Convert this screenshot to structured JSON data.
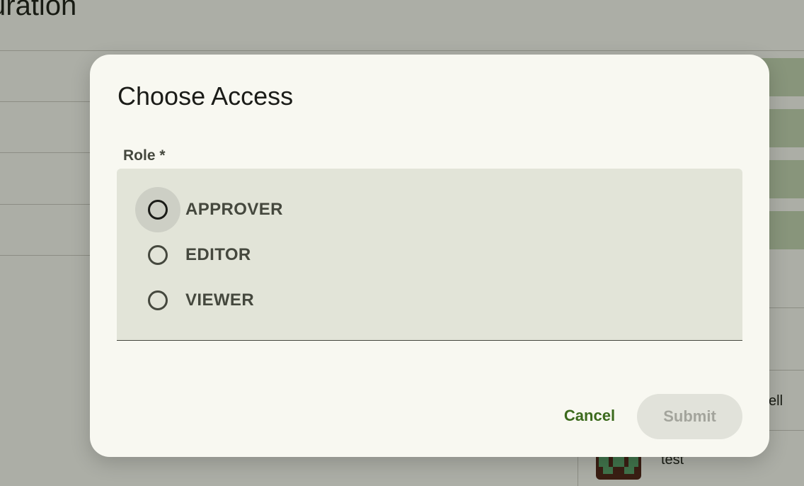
{
  "background": {
    "page_title_fragment": "uration",
    "partial_text": "ell",
    "card_text": "test"
  },
  "dialog": {
    "title": "Choose Access",
    "role_label": "Role *",
    "options": [
      {
        "label": "APPROVER",
        "focused": true
      },
      {
        "label": "EDITOR",
        "focused": false
      },
      {
        "label": "VIEWER",
        "focused": false
      }
    ],
    "cancel_label": "Cancel",
    "submit_label": "Submit"
  },
  "colors": {
    "accent": "#3c6a1d",
    "surface": "#f8f8f1",
    "field": "#e2e4d8",
    "scrim": "rgba(15,18,10,0.32)"
  }
}
